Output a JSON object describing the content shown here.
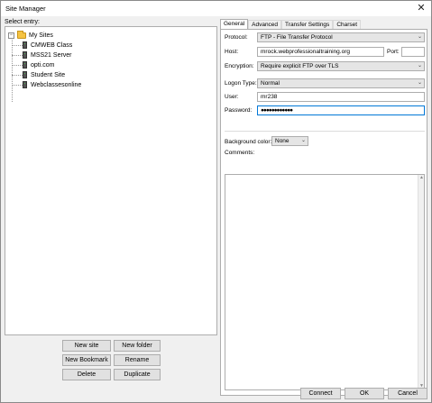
{
  "window": {
    "title": "Site Manager"
  },
  "tree": {
    "label": "Select entry:",
    "root": "My Sites",
    "sites": [
      "CMWEB Class",
      "MSS21 Server",
      "opti.com",
      "Student Site",
      "Webclassesonline"
    ]
  },
  "left_buttons": {
    "new_site": "New site",
    "new_folder": "New folder",
    "new_bookmark": "New Bookmark",
    "rename": "Rename",
    "delete": "Delete",
    "duplicate": "Duplicate"
  },
  "tabs": [
    "General",
    "Advanced",
    "Transfer Settings",
    "Charset"
  ],
  "general": {
    "protocol_label": "Protocol:",
    "protocol_value": "FTP - File Transfer Protocol",
    "host_label": "Host:",
    "host_value": "mrock.webprofessionaltraining.org",
    "port_label": "Port:",
    "port_value": "",
    "encryption_label": "Encryption:",
    "encryption_value": "Require explicit FTP over TLS",
    "logon_label": "Logon Type:",
    "logon_value": "Normal",
    "user_label": "User:",
    "user_value": "mr238",
    "password_label": "Password:",
    "password_value": "●●●●●●●●●●●●",
    "bg_color_label": "Background color:",
    "bg_color_value": "None",
    "comments_label": "Comments:"
  },
  "bottom_buttons": {
    "connect": "Connect",
    "ok": "OK",
    "cancel": "Cancel"
  },
  "colors": {
    "accent": "#0078d7",
    "folder": "#f5c342"
  }
}
